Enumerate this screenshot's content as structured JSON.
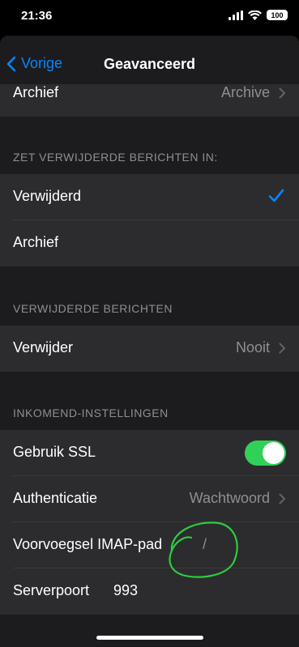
{
  "status": {
    "time": "21:36",
    "battery": "100"
  },
  "nav": {
    "back_label": "Vorige",
    "title": "Geavanceerd"
  },
  "rows": {
    "archive_mailbox": {
      "label": "Archief",
      "value": "Archive"
    },
    "deleted": {
      "label": "Verwijderd"
    },
    "archive": {
      "label": "Archief"
    },
    "remove": {
      "label": "Verwijder",
      "value": "Nooit"
    },
    "ssl": {
      "label": "Gebruik SSL",
      "on": true
    },
    "auth": {
      "label": "Authenticatie",
      "value": "Wachtwoord"
    },
    "imap": {
      "label": "Voorvoegsel IMAP-pad",
      "value": "/"
    },
    "port": {
      "label": "Serverpoort",
      "value": "993"
    }
  },
  "sections": {
    "move_to": "ZET VERWIJDERDE BERICHTEN IN:",
    "deleted_messages": "VERWIJDERDE BERICHTEN",
    "incoming": "INKOMEND-INSTELLINGEN"
  },
  "colors": {
    "accent": "#0a84ff",
    "toggle_on": "#30d158",
    "annotation": "#2ecc40"
  }
}
